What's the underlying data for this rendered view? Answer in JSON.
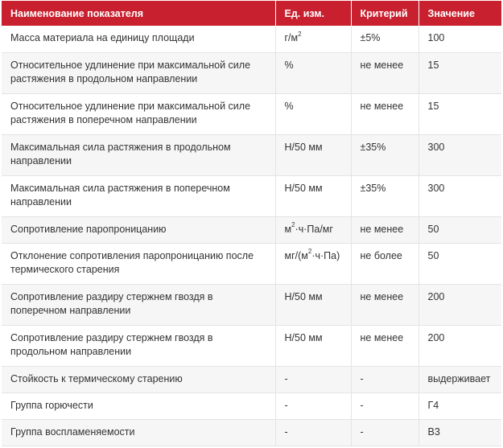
{
  "colors": {
    "header_bg": "#c8202f",
    "header_text": "#ffffff",
    "row_alt": "#f6f6f6",
    "border": "#e4e4e4",
    "text": "#333333"
  },
  "table": {
    "headers": [
      "Наименование показателя",
      "Ед. изм.",
      "Критерий",
      "Значение"
    ],
    "rows": [
      {
        "name": "Масса материала на единицу площади",
        "unit": "г/м",
        "unit_sup": "2",
        "unit_tail": "",
        "criterion": "±5%",
        "value": "100"
      },
      {
        "name": "Относительное удлинение при максимальной силе растяжения в продольном направлении",
        "unit": "%",
        "unit_sup": "",
        "unit_tail": "",
        "criterion": "не менее",
        "value": "15"
      },
      {
        "name": "Относительное удлинение при максимальной силе растяжения в поперечном направлении",
        "unit": "%",
        "unit_sup": "",
        "unit_tail": "",
        "criterion": "не менее",
        "value": "15"
      },
      {
        "name": "Максимальная сила растяжения в продольном направлении",
        "unit": "Н/50 мм",
        "unit_sup": "",
        "unit_tail": "",
        "criterion": "±35%",
        "value": "300"
      },
      {
        "name": "Максимальная сила растяжения в поперечном направлении",
        "unit": "Н/50 мм",
        "unit_sup": "",
        "unit_tail": "",
        "criterion": "±35%",
        "value": "300"
      },
      {
        "name": "Сопротивление паропроницанию",
        "unit": "м",
        "unit_sup": "2",
        "unit_tail": "·ч·Па/мг",
        "criterion": "не менее",
        "value": "50"
      },
      {
        "name": "Отклонение сопротивления паропроницанию после термического старения",
        "unit": "мг/(м",
        "unit_sup": "2",
        "unit_tail": "·ч·Па)",
        "criterion": "не более",
        "value": "50"
      },
      {
        "name": "Сопротивление раздиру стержнем гвоздя в поперечном направлении",
        "unit": "Н/50 мм",
        "unit_sup": "",
        "unit_tail": "",
        "criterion": "не менее",
        "value": "200"
      },
      {
        "name": "Сопротивление раздиру стержнем гвоздя в продольном направлении",
        "unit": "Н/50 мм",
        "unit_sup": "",
        "unit_tail": "",
        "criterion": "не менее",
        "value": "200"
      },
      {
        "name": "Стойкость к термическому старению",
        "unit": "-",
        "unit_sup": "",
        "unit_tail": "",
        "criterion": "-",
        "value": "выдерживает"
      },
      {
        "name": "Группа горючести",
        "unit": "-",
        "unit_sup": "",
        "unit_tail": "",
        "criterion": "-",
        "value": "Г4"
      },
      {
        "name": "Группа воспламеняемости",
        "unit": "-",
        "unit_sup": "",
        "unit_tail": "",
        "criterion": "-",
        "value": "В3"
      }
    ]
  }
}
